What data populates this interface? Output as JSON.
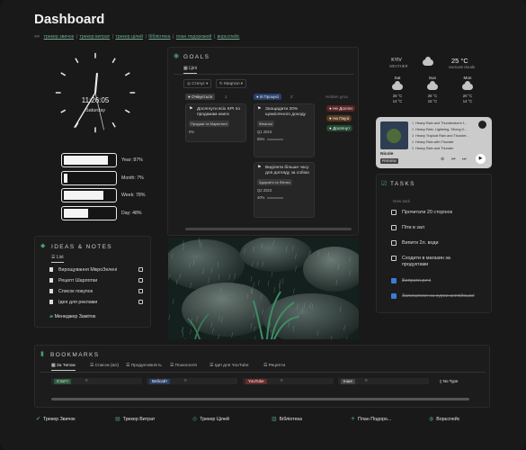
{
  "page": {
    "title": "Dashboard"
  },
  "nav": {
    "arrow": ">>",
    "links": [
      "трекер звичок",
      "трекер витрат",
      "трекер цілей",
      "бібліотека",
      "план подорожей",
      "ворєспейс"
    ],
    "separator": "|"
  },
  "clock": {
    "time": "11:26:05",
    "day": "Saturday"
  },
  "progress": [
    {
      "label": "Year: 87%",
      "value": 0.87
    },
    {
      "label": "Month: 7%",
      "value": 0.07
    },
    {
      "label": "Week: 78%",
      "value": 0.78
    },
    {
      "label": "Day: 48%",
      "value": 0.48
    }
  ],
  "goals": {
    "title": "GOALS",
    "view": "Цілі",
    "filters": [
      "Статус",
      "Квартал"
    ],
    "col1": {
      "name": "Очікується",
      "count": "1"
    },
    "col2": {
      "name": "В Процесі",
      "count": "2"
    },
    "hidden": "Hidden grou",
    "card1": {
      "text": "Досягнути всіх KPI по продажам книги",
      "tag": "Продажі та Маркетинг",
      "pct": "0%"
    },
    "card2": {
      "text": "Заощадити 20% щомісячного доходу",
      "tag": "Фінанси",
      "quarter": "Q1 2023",
      "pct": "65%"
    },
    "card3": {
      "text": "Виділити більше часу для догляду за собою",
      "tag": "Здоров'я та Фітнес",
      "quarter": "Q2 2023",
      "pct": "40%"
    },
    "statuses": [
      "Не Досягн",
      "На Паузі",
      "Досягнут"
    ]
  },
  "weather": {
    "city": "KYIV",
    "label": "WEATHER",
    "temp": "25 °C",
    "desc": "overcast clouds",
    "forecast": [
      {
        "day": "Sat",
        "high": "25 °C",
        "low": "14 °C"
      },
      {
        "day": "Sun",
        "high": "26 °C",
        "low": "15 °C"
      },
      {
        "day": "Mon",
        "high": "20 °C",
        "low": "14 °C"
      }
    ]
  },
  "spotify": {
    "tracks": [
      "Heavy Rain and Thunderstorm f...",
      "Heavy Rain, Lightning, Strong V...",
      "Heavy Tropical Rain and Thunder...",
      "Heavy Rain with Thunder",
      "Heavy Rain and Thunder",
      "Heavy Rain and Thunder"
    ],
    "artist": "Nicole",
    "badge": "PREVIEW"
  },
  "tasks": {
    "title": "TASKS",
    "new": "New task",
    "items": [
      {
        "text": "Прочитати 20 сторінок",
        "done": false
      },
      {
        "text": "Піти в зал",
        "done": false
      },
      {
        "text": "Випити 2л. води",
        "done": false
      },
      {
        "text": "Сходити в магазин за продуктами",
        "done": false
      },
      {
        "text": "Випрати речі",
        "done": true
      },
      {
        "text": "Записатися на курси англійської",
        "done": true
      }
    ]
  },
  "ideas": {
    "title": "IDEAS & NOTES",
    "view": "List",
    "items": [
      "Вирощування МікроЗелені",
      "Рецепт Шарлотки",
      "Список покупок",
      "Ідея для реклами"
    ],
    "manager": "Менеджер Заміток"
  },
  "bookmarks": {
    "title": "BOOKMARKS",
    "tabs": [
      "За Типом",
      "Список (всі)",
      "Продуктивність",
      "Психологія",
      "Ідеї для YouTube",
      "Рецепти"
    ],
    "columns": [
      {
        "name": "Статті",
        "color": "#2d5a3c"
      },
      {
        "name": "Вебсайт",
        "color": "#2b3f63"
      },
      {
        "name": "YouTube",
        "color": "#6a2a2a"
      },
      {
        "name": "Інше",
        "color": "#444444"
      },
      {
        "name": "No Type",
        "color": "#262626"
      }
    ],
    "zero": "0"
  },
  "footer": [
    "Трекер Звичок",
    "Трекер Витрат",
    "Трекер Цілей",
    "Бібліотека",
    "План Подоро...",
    "Ворєспейс"
  ]
}
